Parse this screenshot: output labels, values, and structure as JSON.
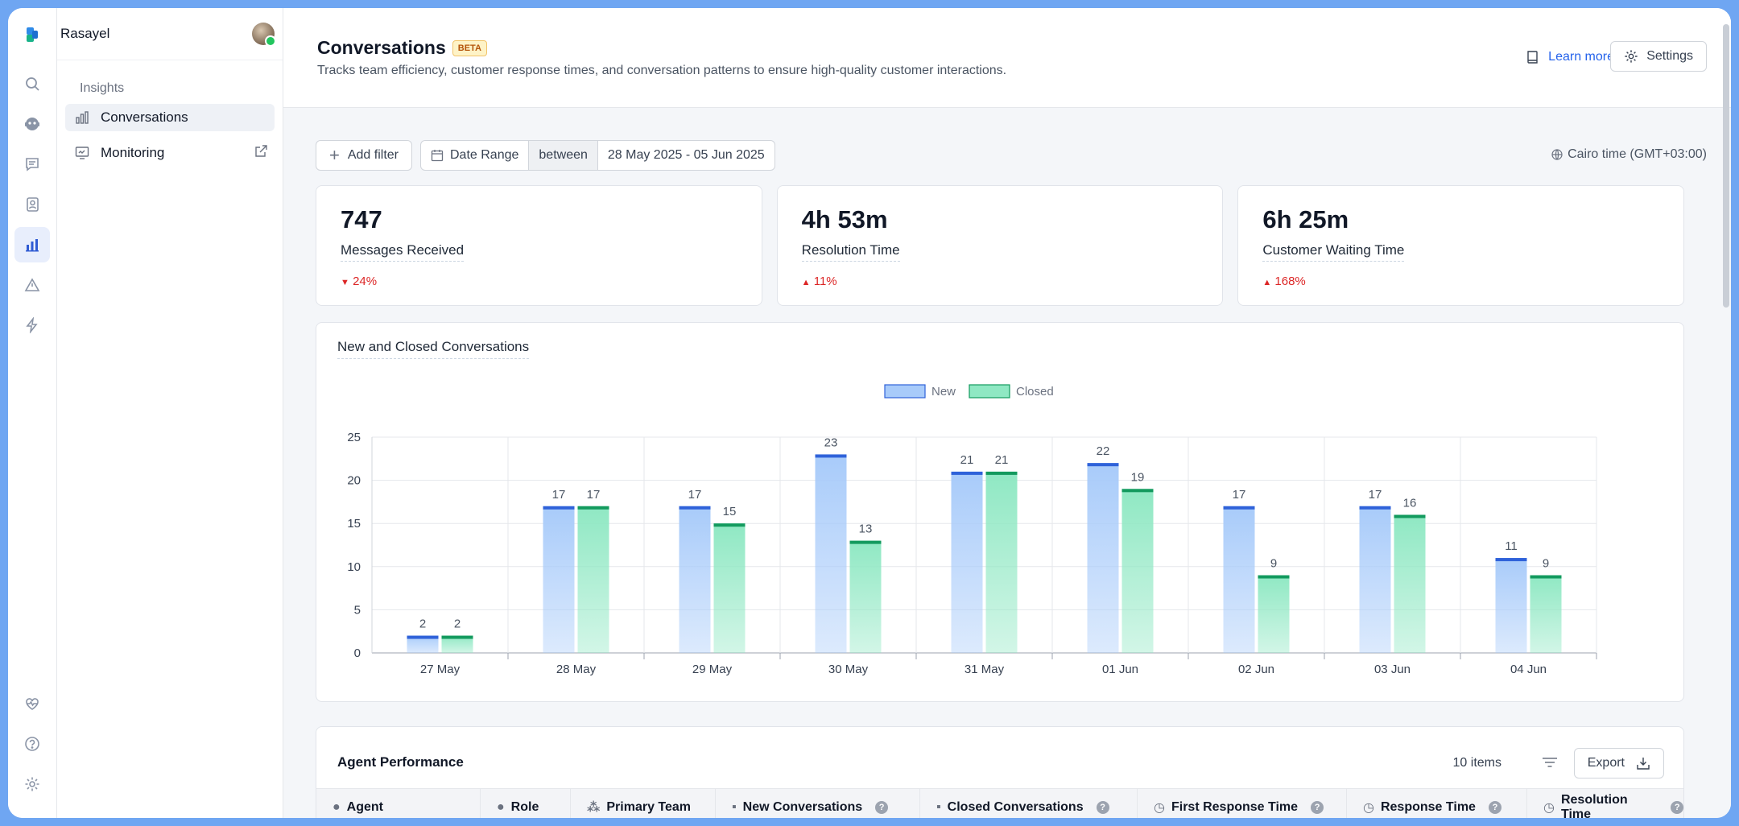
{
  "app": {
    "name": "Rasayel"
  },
  "nav": {
    "section": "Insights",
    "items": [
      {
        "label": "Conversations",
        "active": true
      },
      {
        "label": "Monitoring",
        "active": false
      }
    ]
  },
  "header": {
    "title": "Conversations",
    "badge": "BETA",
    "description": "Tracks team efficiency, customer response times, and conversation patterns to ensure high-quality customer interactions.",
    "learn_more": "Learn more",
    "settings": "Settings"
  },
  "filters": {
    "add_filter": "Add filter",
    "date_range": "Date Range",
    "operator": "between",
    "value": "28 May 2025 - 05 Jun 2025",
    "timezone": "Cairo time (GMT+03:00)"
  },
  "kpis": [
    {
      "value": "747",
      "label": "Messages Received",
      "change": "24%",
      "direction": "down"
    },
    {
      "value": "4h 53m",
      "label": "Resolution Time",
      "change": "11%",
      "direction": "up"
    },
    {
      "value": "6h 25m",
      "label": "Customer Waiting Time",
      "change": "168%",
      "direction": "up"
    }
  ],
  "chart_card": {
    "title": "New and Closed Conversations"
  },
  "chart_data": {
    "type": "bar",
    "title": "New and Closed Conversations",
    "categories": [
      "27 May",
      "28 May",
      "29 May",
      "30 May",
      "31 May",
      "01 Jun",
      "02 Jun",
      "03 Jun",
      "04 Jun"
    ],
    "series": [
      {
        "name": "New",
        "values": [
          2,
          17,
          17,
          23,
          21,
          22,
          17,
          17,
          11
        ],
        "color": "#a8cbfa",
        "accent": "#2f62d9"
      },
      {
        "name": "Closed",
        "values": [
          2,
          17,
          15,
          13,
          21,
          19,
          9,
          16,
          9
        ],
        "color": "#8fe8c3",
        "accent": "#139a5e"
      }
    ],
    "yticks": [
      0,
      5,
      10,
      15,
      20,
      25
    ],
    "ylim": [
      0,
      25
    ],
    "grid": true,
    "legend": "top-center"
  },
  "agent_performance": {
    "title": "Agent Performance",
    "count": "10 items",
    "export": "Export",
    "columns": [
      "Agent",
      "Role",
      "Primary Team",
      "New Conversations",
      "Closed Conversations",
      "First Response Time",
      "Response Time",
      "Resolution Time"
    ]
  }
}
